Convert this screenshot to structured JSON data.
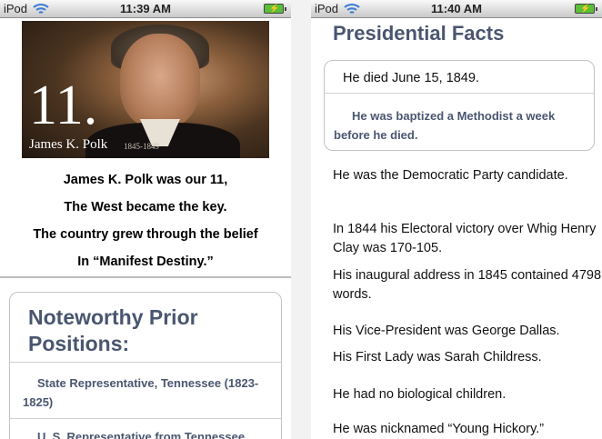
{
  "left": {
    "status": {
      "device": "iPod",
      "time": "11:39 AM"
    },
    "portrait": {
      "number": "11.",
      "name": "James K. Polk",
      "years": "1845-1849"
    },
    "poem": [
      "James K. Polk was our 11,",
      "The West became the key.",
      "The country grew through the belief",
      "In “Manifest Destiny.”"
    ],
    "positions": {
      "heading": "Noteworthy Prior Positions:",
      "items": [
        "State Representative, Tennessee (1823-1825)"
      ],
      "partial_item": "U. S. Representative from Tennessee"
    }
  },
  "right": {
    "status": {
      "device": "iPod",
      "time": "11:40 AM"
    },
    "title": "Presidential Facts",
    "card": {
      "death": "He died June 15, 1849.",
      "baptism": "He was baptized a Methodist a week before he died."
    },
    "facts": [
      "He was the Democratic Party candidate.",
      "In 1844 his Electoral victory over Whig Henry Clay was 170-105.",
      "His inaugural address in 1845 contained 4798 words.",
      "His Vice-President was George Dallas.",
      "His First Lady was Sarah Childress.",
      "He had no biological children.",
      "He was nicknamed “Young Hickory.”"
    ]
  }
}
